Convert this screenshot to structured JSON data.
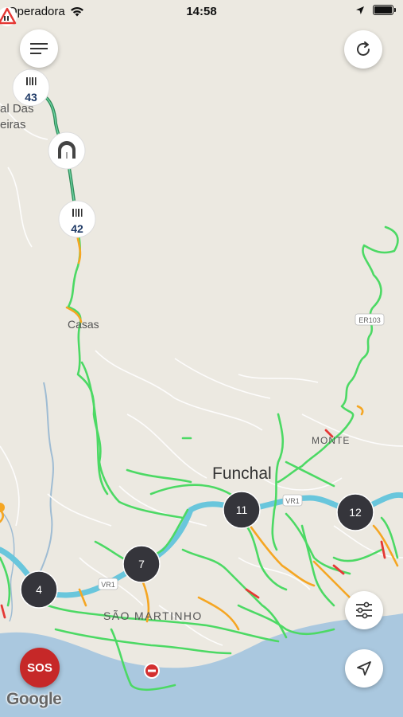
{
  "status_bar": {
    "carrier": "Operadora",
    "time": "14:58"
  },
  "map": {
    "place_labels": [
      "al Das",
      "eiras",
      "Casas",
      "Funchal",
      "MONTE",
      "SÃO MARTINHO"
    ],
    "road_labels": [
      "ER103",
      "VR1",
      "VR1"
    ],
    "markers": {
      "tollgate_north": "43",
      "tollgate_south": "42",
      "cluster_4": "4",
      "cluster_7": "7",
      "cluster_11": "11",
      "cluster_12": "12"
    },
    "colors": {
      "land": "#ece9e1",
      "sea": "#aac8df",
      "expressway": "#69c6dc",
      "free_flow": "#4cd964",
      "slow": "#f5a623",
      "jam": "#e53935",
      "cluster": "#35353b"
    }
  },
  "buttons": {
    "menu_icon": "menu-icon",
    "refresh_icon": "refresh-icon",
    "filters_icon": "sliders-icon",
    "locate_icon": "location-arrow-icon",
    "sos_label": "SOS"
  },
  "attribution": "Google"
}
